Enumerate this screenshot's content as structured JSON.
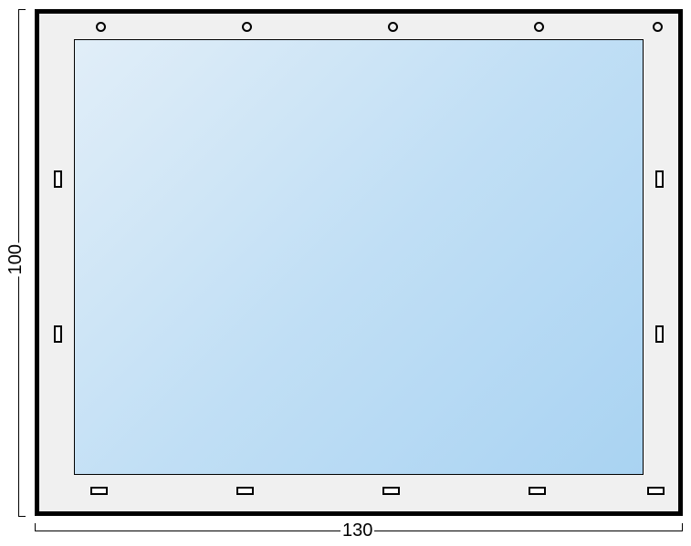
{
  "dimensions": {
    "height_label": "100",
    "width_label": "130"
  },
  "holes": {
    "top_circles_count": 5,
    "bottom_rects_count": 5,
    "left_rects_count": 2,
    "right_rects_count": 2
  }
}
